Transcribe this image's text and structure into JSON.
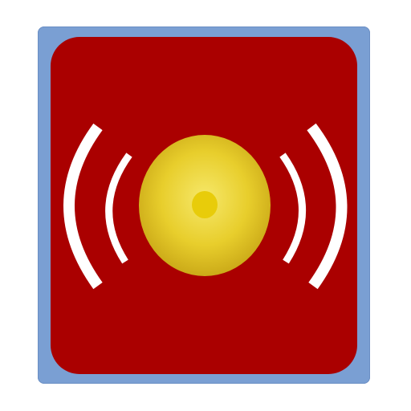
{
  "icon": {
    "name": "alarm-siren-icon",
    "colors": {
      "frame": "#7a9fd3",
      "panel": "#aa0000",
      "waves": "#ffffff",
      "bell_light": "#f4e45a",
      "bell_dark": "#c9a616",
      "center": "#e8cc0a"
    }
  }
}
